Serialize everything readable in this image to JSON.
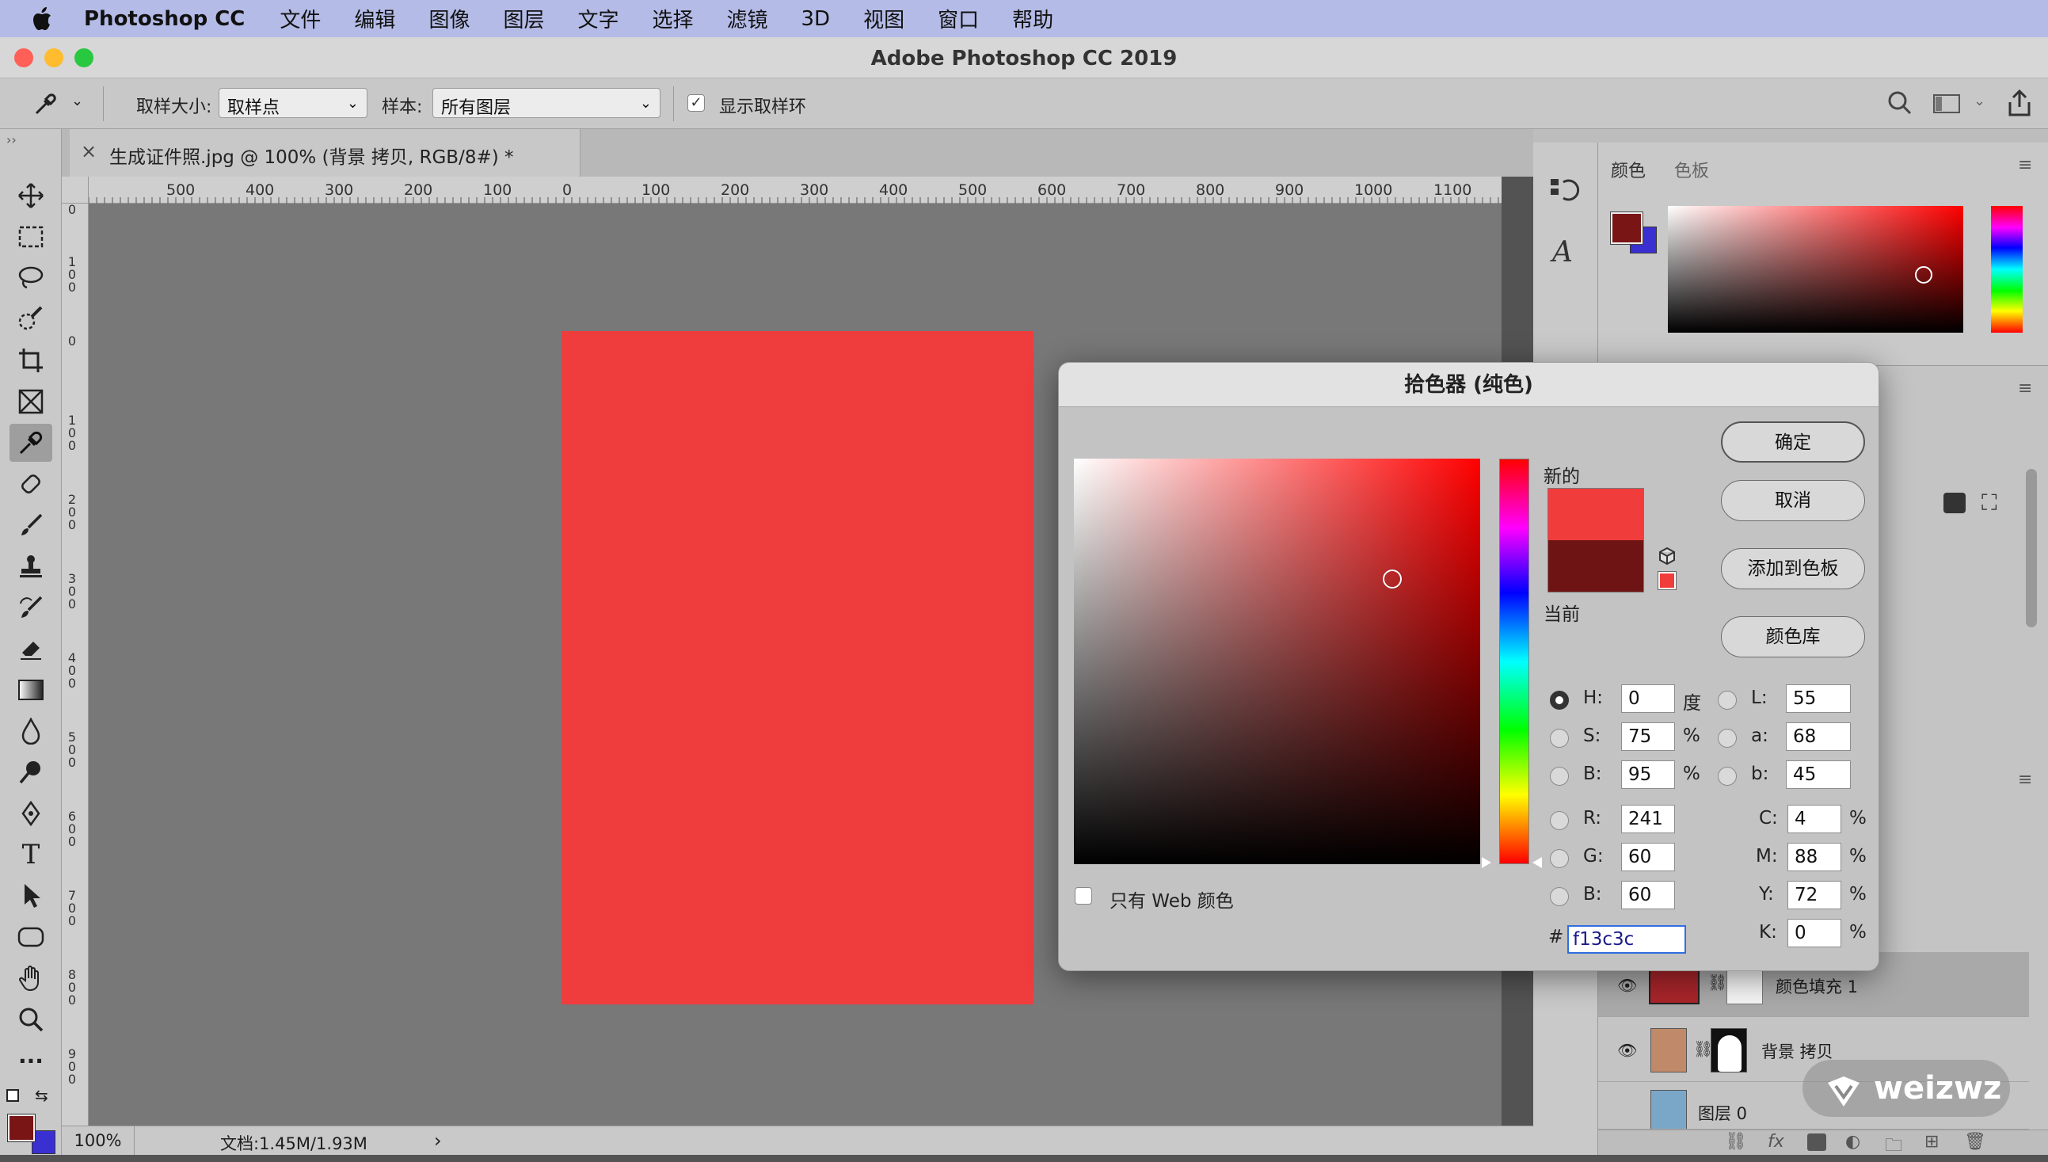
{
  "menubar": {
    "app_name": "Photoshop CC",
    "items": [
      "文件",
      "编辑",
      "图像",
      "图层",
      "文字",
      "选择",
      "滤镜",
      "3D",
      "视图",
      "窗口",
      "帮助"
    ]
  },
  "window": {
    "title": "Adobe Photoshop CC 2019",
    "lights": {
      "close": "#fe5f57",
      "minimize": "#febc2e",
      "zoom": "#28c840"
    }
  },
  "options_bar": {
    "sample_size_label": "取样大小:",
    "sample_size_value": "取样点",
    "sample_label": "样本:",
    "sample_value": "所有图层",
    "show_ring_label": "显示取样环",
    "show_ring_checked": true
  },
  "document": {
    "tab_title": "生成证件照.jpg @ 100% (背景 拷贝, RGB/8#) *",
    "close_glyph": "×",
    "canvas_color": "#ef3c3d",
    "ruler_h": [
      "500",
      "400",
      "300",
      "200",
      "100",
      "0",
      "100",
      "200",
      "300",
      "400",
      "500",
      "600",
      "700",
      "800",
      "900",
      "1000",
      "1100"
    ],
    "ruler_v": [
      "0",
      "1 0 0",
      "0",
      "1 0 0",
      "2 0 0",
      "3 0 0",
      "4 0 0",
      "5 0 0",
      "6 0 0",
      "7 0 0",
      "8 0 0",
      "9 0 0"
    ]
  },
  "status": {
    "zoom": "100%",
    "doc_size": "文档:1.45M/1.93M",
    "arrow": "›"
  },
  "color_panel": {
    "tab_color": "颜色",
    "tab_swatches": "色板",
    "foreground": "#7a1515",
    "background": "#3a2fd0"
  },
  "layers": [
    {
      "name": "颜色填充 1",
      "selected": true
    },
    {
      "name": "背景 拷贝",
      "selected": false
    },
    {
      "name": "图层 0",
      "selected": false
    }
  ],
  "picker": {
    "title": "拾色器 (纯色)",
    "new_label": "新的",
    "current_label": "当前",
    "new_color": "#f13c3c",
    "current_color": "#6f1414",
    "buttons": {
      "ok": "确定",
      "cancel": "取消",
      "add_swatch": "添加到色板",
      "libraries": "颜色库"
    },
    "web_only_label": "只有 Web 颜色",
    "hsb": {
      "h": "0",
      "s": "75",
      "b": "95",
      "h_unit": "度",
      "s_unit": "%",
      "b_unit": "%"
    },
    "lab": {
      "l": "55",
      "a": "68",
      "b": "45"
    },
    "rgb": {
      "r": "241",
      "g": "60",
      "b": "60"
    },
    "cmyk": {
      "c": "4",
      "m": "88",
      "y": "72",
      "k": "0"
    },
    "labels": {
      "H": "H:",
      "S": "S:",
      "B": "B:",
      "L": "L:",
      "a": "a:",
      "b2": "b:",
      "R": "R:",
      "G": "G:",
      "B2": "B:",
      "C": "C:",
      "M": "M:",
      "Y": "Y:",
      "K": "K:"
    },
    "pct": "%",
    "hash": "#",
    "hex": "f13c3c"
  },
  "watermark": "weizwz"
}
